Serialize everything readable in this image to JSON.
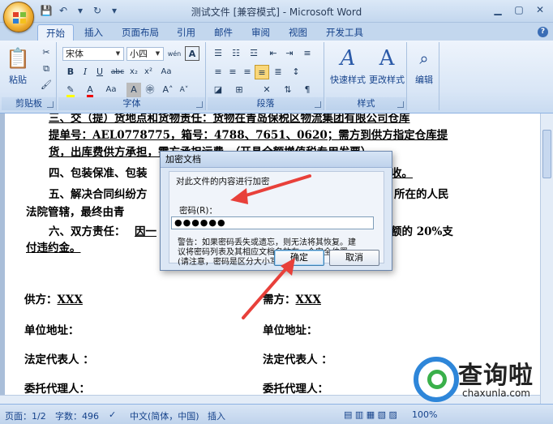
{
  "window": {
    "title": "测试文件 [兼容模式] - Microsoft Word"
  },
  "tabs": [
    {
      "label": "开始",
      "active": true
    },
    {
      "label": "插入"
    },
    {
      "label": "页面布局"
    },
    {
      "label": "引用"
    },
    {
      "label": "邮件"
    },
    {
      "label": "审阅"
    },
    {
      "label": "视图"
    },
    {
      "label": "开发工具"
    }
  ],
  "ribbon": {
    "clipboard": {
      "label": "剪贴板",
      "paste": "粘贴"
    },
    "font": {
      "label": "字体",
      "font_name": "宋体",
      "font_size": "小四",
      "bold": "B",
      "italic": "I",
      "underline": "U",
      "strike": "abc",
      "subscript": "x₂",
      "superscript": "x²",
      "aa": "Aa",
      "grow": "A",
      "shrink": "A",
      "clear": "A",
      "phonetic": "wén",
      "char_border": "A"
    },
    "paragraph": {
      "label": "段落"
    },
    "styles": {
      "label": "样式",
      "quick_styles": "快速样式",
      "change_styles": "更改样式"
    },
    "editing": {
      "label": "编辑"
    }
  },
  "document": {
    "line1_prefix": "三、交（提）货地点和货物责任：",
    "line1_rest": "货物在青岛保税区物流集团有限公司仓库",
    "line2": "提单号：AEL0778775，箱号：4788、7651、0620；需方到供方指定仓库提",
    "line3": "货，出库费供方承担，需方承担运费。（开具全额增值税专用发票）。",
    "line4_prefix": "四、包装保准、包装",
    "line4_suffix": "收。",
    "line5_prefix": "五、解决合同纠纷方",
    "line5_suffix": "所在的人民",
    "line6_prefix": "法院管辖，最终由青",
    "line7_prefix": "六、双方责任：",
    "line7_mid": "因一",
    "line7_suffix": "额的 20%支",
    "line8": "付违约金。",
    "supplier_label": "供方：",
    "supplier_value": "XXX",
    "buyer_label": "需方：",
    "buyer_value": "XXX",
    "address_label": "单位地址：",
    "rep_label": "法定代表人 ：",
    "agent_label": "委托代理人："
  },
  "dialog": {
    "title": "加密文档",
    "instruction": "对此文件的内容进行加密",
    "password_label": "密码(R)：",
    "password_value": "●●●●●●",
    "warning_line1": "警告：如果密码丢失或遗忘，则无法将其恢复。建",
    "warning_line2": "议将密码列表及其相应文档名放在一个安全位置。",
    "warning_line3": "(请注意，密码是区分大小写的。)",
    "ok": "确定",
    "cancel": "取消"
  },
  "status": {
    "page": "页面：1/2",
    "words": "字数：496",
    "language": "中文(简体，中国)",
    "insert": "插入",
    "zoom": "100%"
  },
  "watermark": {
    "brand": "查询啦",
    "url": "chaxunla.com"
  },
  "colors": {
    "arrow": "#e8403a",
    "watermark_blue": "#2e86d9",
    "watermark_green": "#3ab04a"
  }
}
